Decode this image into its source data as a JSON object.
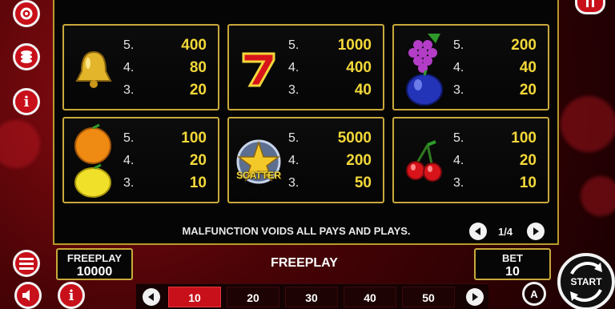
{
  "paytable": {
    "cards": [
      {
        "symbol": "bell",
        "rows": [
          {
            "n": "5.",
            "v": "400"
          },
          {
            "n": "4.",
            "v": "80"
          },
          {
            "n": "3.",
            "v": "20"
          }
        ]
      },
      {
        "symbol": "seven",
        "rows": [
          {
            "n": "5.",
            "v": "1000"
          },
          {
            "n": "4.",
            "v": "400"
          },
          {
            "n": "3.",
            "v": "40"
          }
        ]
      },
      {
        "symbol": "grapes-plum",
        "rows": [
          {
            "n": "5.",
            "v": "200"
          },
          {
            "n": "4.",
            "v": "40"
          },
          {
            "n": "3.",
            "v": "20"
          }
        ]
      },
      {
        "symbol": "orange-lemon",
        "rows": [
          {
            "n": "5.",
            "v": "100"
          },
          {
            "n": "4.",
            "v": "20"
          },
          {
            "n": "3.",
            "v": "10"
          }
        ]
      },
      {
        "symbol": "scatter",
        "scatter_label": "SCATTER",
        "rows": [
          {
            "n": "5.",
            "v": "5000"
          },
          {
            "n": "4.",
            "v": "200"
          },
          {
            "n": "3.",
            "v": "50"
          }
        ]
      },
      {
        "symbol": "cherries",
        "rows": [
          {
            "n": "5.",
            "v": "100"
          },
          {
            "n": "4.",
            "v": "20"
          },
          {
            "n": "3.",
            "v": "10"
          }
        ]
      }
    ],
    "malfunction": "MALFUNCTION VOIDS ALL PAYS AND PLAYS.",
    "page_indicator": "1/4"
  },
  "footer": {
    "freeplay_label": "FREEPLAY",
    "freeplay_value": "10000",
    "center_label": "FREEPLAY",
    "bet_label": "BET",
    "bet_value": "10",
    "bet_options": [
      "10",
      "20",
      "30",
      "40",
      "50"
    ],
    "selected_bet": "10",
    "start_label": "START"
  },
  "colors": {
    "accent_gold": "#f3d83a",
    "frame_gold": "#c9a93a",
    "brand_red": "#c8101a"
  }
}
